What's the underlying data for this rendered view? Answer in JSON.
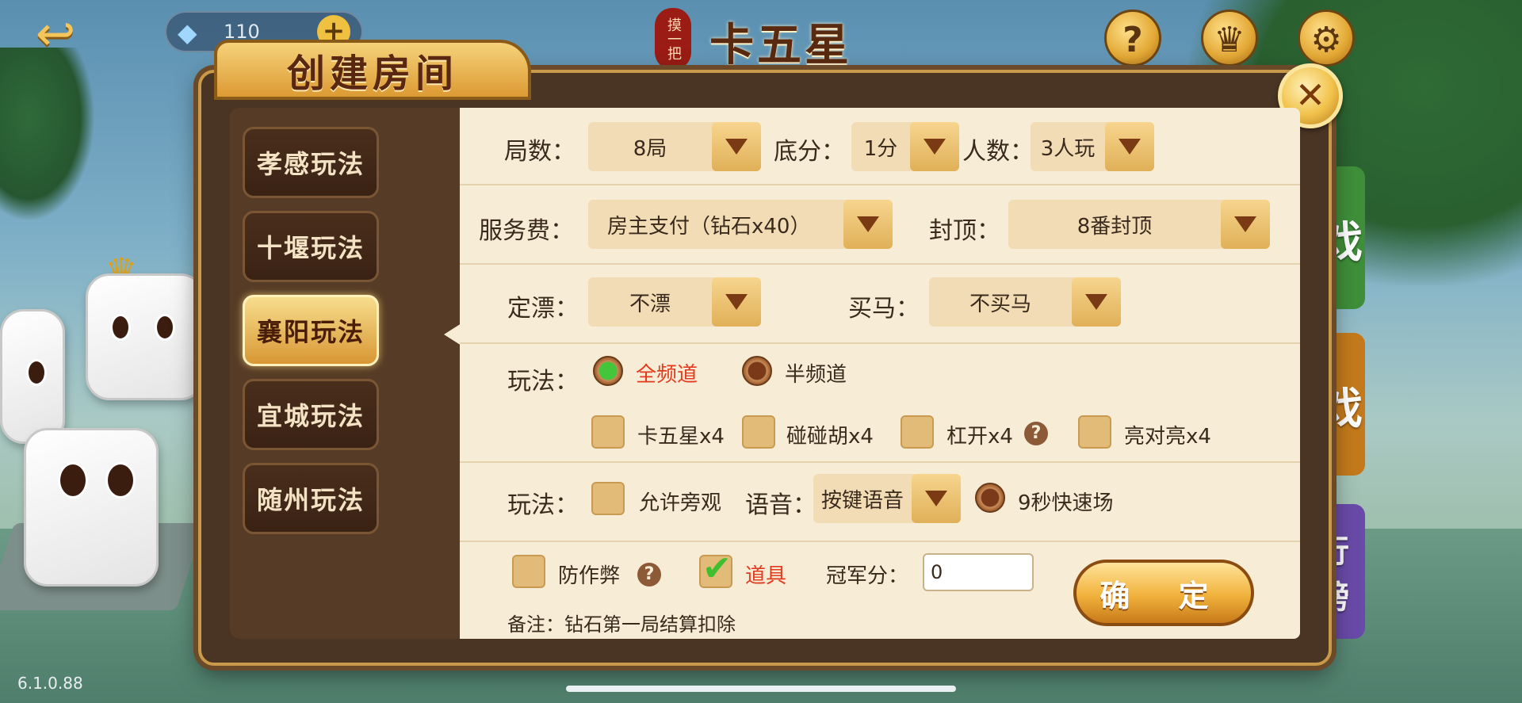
{
  "topbar": {
    "diamond_count": "110",
    "plus_label": "+",
    "seal_text": "摸一把",
    "game_title": "卡五星",
    "icons": [
      {
        "name": "rules",
        "glyph": "?",
        "label": "玩法"
      },
      {
        "name": "record",
        "glyph": "♛",
        "label": "战绩"
      },
      {
        "name": "settings",
        "glyph": "⚙",
        "label": ""
      }
    ]
  },
  "dialog": {
    "title": "创建房间",
    "close_glyph": "✕",
    "sidebar": [
      {
        "label": "孝感玩法",
        "active": false
      },
      {
        "label": "十堰玩法",
        "active": false
      },
      {
        "label": "襄阳玩法",
        "active": true
      },
      {
        "label": "宜城玩法",
        "active": false
      },
      {
        "label": "随州玩法",
        "active": false
      }
    ],
    "rounds": {
      "label": "局数：",
      "value": "8局"
    },
    "base_score": {
      "label": "底分：",
      "value": "1分"
    },
    "players": {
      "label": "人数：",
      "value": "3人玩"
    },
    "service_fee": {
      "label": "服务费：",
      "value": "房主支付（钻石x40）"
    },
    "cap": {
      "label": "封顶：",
      "value": "8番封顶"
    },
    "piao": {
      "label": "定漂：",
      "value": "不漂"
    },
    "maima": {
      "label": "买马：",
      "value": "不买马"
    },
    "mode": {
      "label": "玩法：",
      "options": [
        {
          "label": "全频道",
          "selected": true
        },
        {
          "label": "半频道",
          "selected": false
        }
      ],
      "checks": [
        {
          "label": "卡五星x4",
          "checked": false
        },
        {
          "label": "碰碰胡x4",
          "checked": false
        },
        {
          "label": "杠开x4",
          "checked": false,
          "help": true
        },
        {
          "label": "亮对亮x4",
          "checked": false
        }
      ]
    },
    "extra": {
      "label": "玩法：",
      "spectate": {
        "label": "允许旁观",
        "checked": false
      },
      "voice_label": "语音：",
      "voice_value": "按键语音",
      "quick": {
        "label": "9秒快速场",
        "selected": false
      }
    },
    "anti_cheat": {
      "label": "防作弊",
      "checked": false
    },
    "props": {
      "label": "道具",
      "checked": true
    },
    "champion": {
      "label": "冠军分：",
      "value": "0"
    },
    "note": "备注：钻石第一局结算扣除",
    "confirm_label": "确 定"
  },
  "right_tabs": [
    {
      "glyph": "戏",
      "color": "#3f8f3a"
    },
    {
      "glyph": "戏",
      "color": "#c47a1c"
    },
    {
      "glyph": "行榜",
      "color": "#6a4aa8"
    }
  ],
  "version": "6.1.0.88",
  "help_glyph": "?"
}
